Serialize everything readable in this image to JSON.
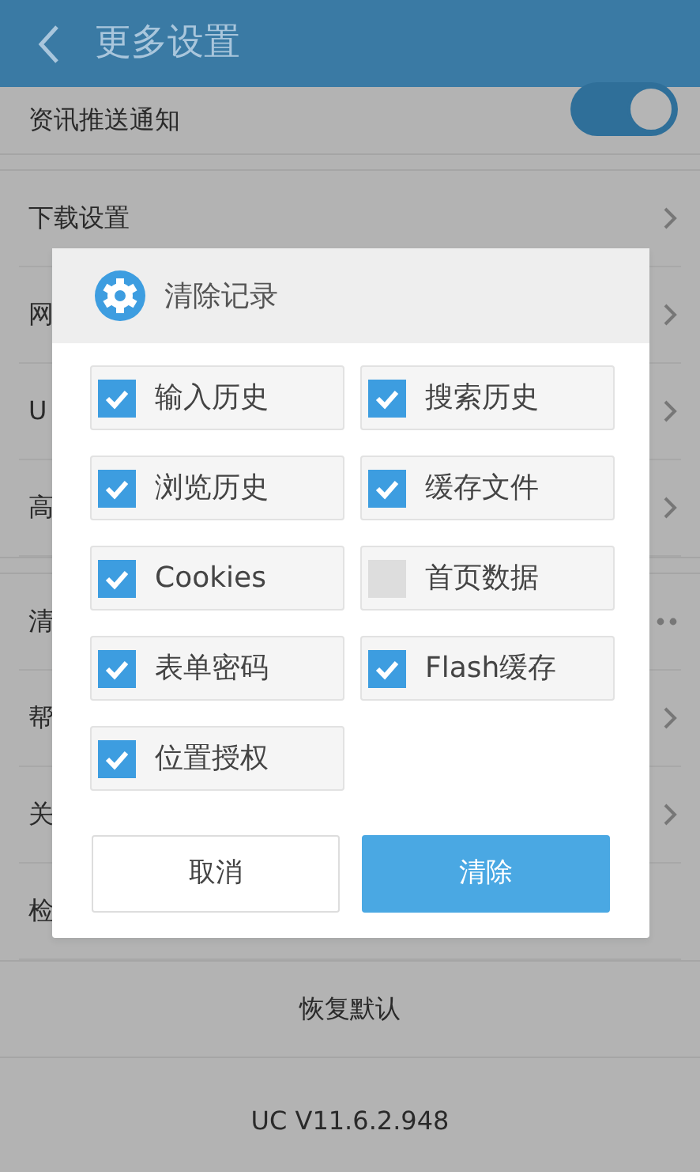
{
  "app_bar": {
    "title": "更多设置"
  },
  "push_row": {
    "label": "资讯推送通知",
    "on": true
  },
  "groups": [
    [
      {
        "label": "下载设置",
        "kind": "chevron"
      },
      {
        "label": "网",
        "kind": "chevron"
      },
      {
        "label": "U",
        "kind": "chevron"
      },
      {
        "label": "高",
        "kind": "chevron"
      }
    ],
    [
      {
        "label": "清",
        "kind": "more"
      },
      {
        "label": "帮",
        "kind": "chevron"
      },
      {
        "label": "关",
        "kind": "chevron"
      },
      {
        "label": "检",
        "kind": "plain"
      }
    ]
  ],
  "restore_button": "恢复默认",
  "version": "UC V11.6.2.948",
  "dialog": {
    "title": "清除记录",
    "options": [
      {
        "label": "输入历史",
        "checked": true
      },
      {
        "label": "搜索历史",
        "checked": true
      },
      {
        "label": "浏览历史",
        "checked": true
      },
      {
        "label": "缓存文件",
        "checked": true
      },
      {
        "label": "Cookies",
        "checked": true
      },
      {
        "label": "首页数据",
        "checked": false
      },
      {
        "label": "表单密码",
        "checked": true
      },
      {
        "label": "Flash缓存",
        "checked": true
      },
      {
        "label": "位置授权",
        "checked": true
      }
    ],
    "buttons": [
      {
        "label": "取消",
        "kind": "secondary"
      },
      {
        "label": "清除",
        "kind": "primary"
      }
    ]
  }
}
